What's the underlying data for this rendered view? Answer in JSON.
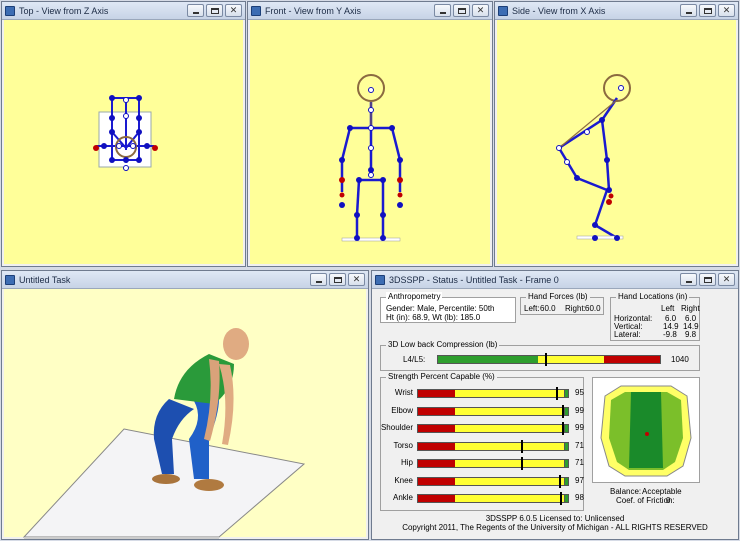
{
  "windows": {
    "top_view": {
      "title": "Top - View from Z Axis"
    },
    "front_view": {
      "title": "Front - View from Y Axis"
    },
    "side_view": {
      "title": "Side - View from X Axis"
    },
    "task_view": {
      "title": "Untitled Task"
    },
    "status": {
      "title": "3DSSPP - Status - Untitled Task - Frame 0"
    }
  },
  "anthropometry": {
    "group_title": "Anthropometry",
    "line1": "Gender: Male, Percentile: 50th",
    "line2": "Ht (in): 68.9, Wt (lb): 185.0"
  },
  "hand_forces": {
    "group_title": "Hand Forces (lb)",
    "left_label": "Left:",
    "left_value": "60.0",
    "right_label": "Right:",
    "right_value": "60.0"
  },
  "hand_locations": {
    "group_title": "Hand Locations (in)",
    "col_left": "Left",
    "col_right": "Right",
    "rows": [
      {
        "label": "Horizontal:",
        "left": "6.0",
        "right": "6.0"
      },
      {
        "label": "Vertical:",
        "left": "14.9",
        "right": "14.9"
      },
      {
        "label": "Lateral:",
        "left": "-9.8",
        "right": "9.8"
      }
    ]
  },
  "compression": {
    "group_title": "3D Low back Compression (lb)",
    "label": "L4/L5:",
    "value": "1040",
    "marker_fraction": 0.48
  },
  "strength": {
    "group_title": "Strength Percent Capable (%)",
    "rows": [
      {
        "label": "Wrist",
        "value": "95",
        "fraction": 0.95
      },
      {
        "label": "Elbow",
        "value": "99",
        "fraction": 0.99
      },
      {
        "label": "Shoulder",
        "value": "99",
        "fraction": 0.99
      },
      {
        "label": "Torso",
        "value": "71",
        "fraction": 0.71
      },
      {
        "label": "Hip",
        "value": "71",
        "fraction": 0.71
      },
      {
        "label": "Knee",
        "value": "97",
        "fraction": 0.97
      },
      {
        "label": "Ankle",
        "value": "98",
        "fraction": 0.98
      }
    ]
  },
  "balance": {
    "status_label": "Balance:",
    "status_value": "Acceptable",
    "friction_label": "Coef. of Friction:",
    "friction_value": "0"
  },
  "footer": {
    "license": "3DSSPP 6.0.5 Licensed to: Unlicensed",
    "copyright": "Copyright 2011, The Regents of the University of Michigan - ALL RIGHTS RESERVED"
  },
  "colors": {
    "view_background": "#ffff99",
    "bar_red": "#c00000",
    "bar_yellow": "#ffff33",
    "bar_green": "#2e9e2e",
    "joint_blue": "#1010c0",
    "joint_red": "#c00000"
  }
}
